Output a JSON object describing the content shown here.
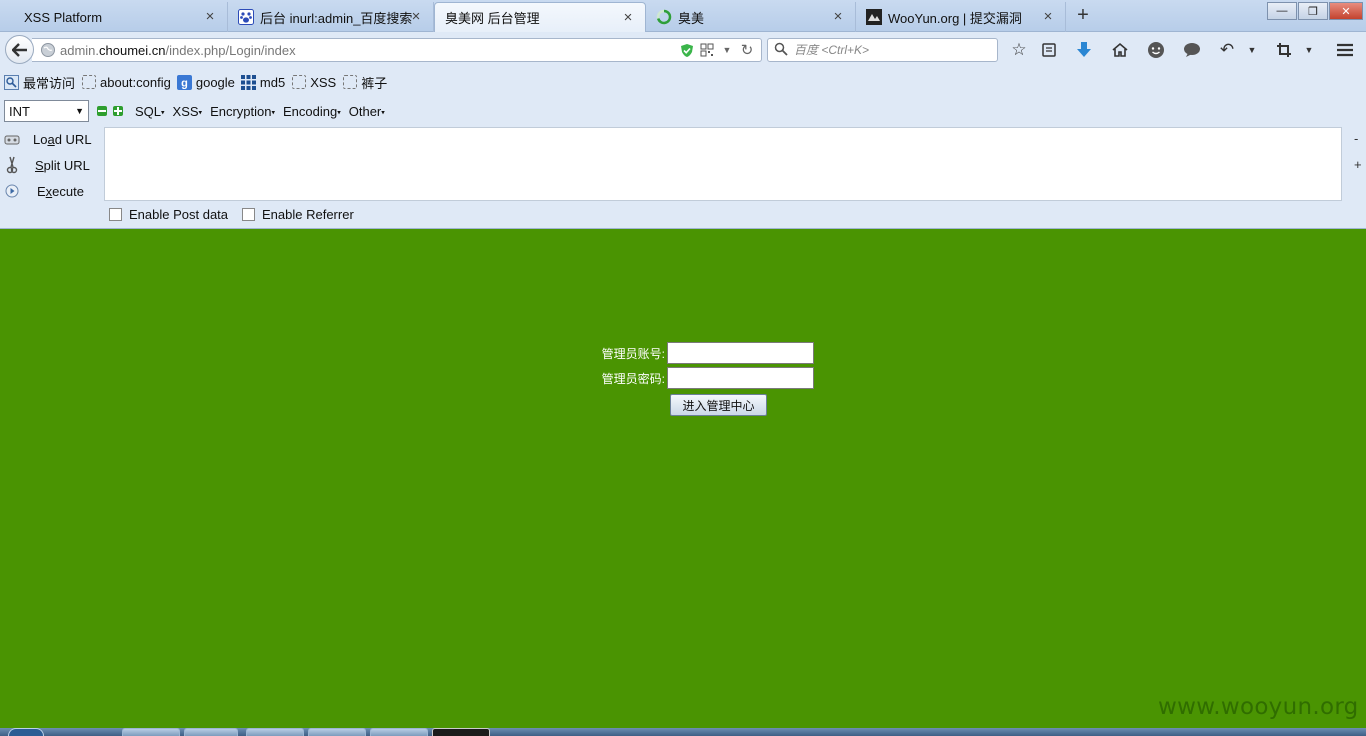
{
  "browser": {
    "tabs": [
      {
        "label": "XSS Platform",
        "icon": "none"
      },
      {
        "label": "后台 inurl:admin_百度搜索",
        "icon": "baidu-paw-icon"
      },
      {
        "label": "臭美网 后台管理",
        "icon": "none",
        "active": true
      },
      {
        "label": "臭美",
        "icon": "loading-spinner-icon"
      },
      {
        "label": "WooYun.org | 提交漏洞",
        "icon": "wooyun-icon"
      }
    ],
    "close_glyph": "×",
    "new_tab_glyph": "+",
    "window_controls": {
      "minimize": "—",
      "restore": "❐",
      "close": "✕"
    },
    "address": {
      "prefix": "admin.",
      "domain": "choumei.cn",
      "path": "/index.php/Login/index"
    },
    "search": {
      "placeholder": "百度 <Ctrl+K>"
    },
    "toolbar_icons": [
      "bookmark-star-icon",
      "reading-list-icon",
      "download-arrow-icon",
      "home-icon",
      "smiley-icon",
      "chat-bubble-icon",
      "undo-icon",
      "dropdown-icon",
      "crop-icon",
      "dropdown-icon",
      "menu-icon"
    ],
    "bookmarks": [
      {
        "label": "最常访问",
        "icon": "most-visited-icon"
      },
      {
        "label": "about:config",
        "icon": "blank-page-icon"
      },
      {
        "label": "google",
        "icon": "google-icon"
      },
      {
        "label": "md5",
        "icon": "grid-icon"
      },
      {
        "label": "XSS",
        "icon": "blank-page-icon"
      },
      {
        "label": "裤子",
        "icon": "blank-page-icon"
      }
    ]
  },
  "hackbar": {
    "select_value": "INT",
    "menus": [
      "SQL",
      "XSS",
      "Encryption",
      "Encoding",
      "Other"
    ],
    "actions": {
      "load_url": {
        "before": "Lo",
        "under": "a",
        "after": "d URL"
      },
      "split_url": {
        "before": "",
        "under": "S",
        "after": "plit URL"
      },
      "execute": {
        "before": "E",
        "under": "x",
        "after": "ecute"
      }
    },
    "textarea_value": "",
    "side_minus": "-",
    "side_plus": "+",
    "enable_post": "Enable Post data",
    "enable_referrer": "Enable Referrer"
  },
  "login": {
    "account_label": "管理员账号:",
    "password_label": "管理员密码:",
    "account_value": "",
    "password_value": "",
    "submit_label": "进入管理中心"
  },
  "watermark": "www.wooyun.org",
  "colors": {
    "page_background": "#4a9402",
    "chrome_background": "#dfe9f6",
    "watermark": "#2f6b00"
  }
}
